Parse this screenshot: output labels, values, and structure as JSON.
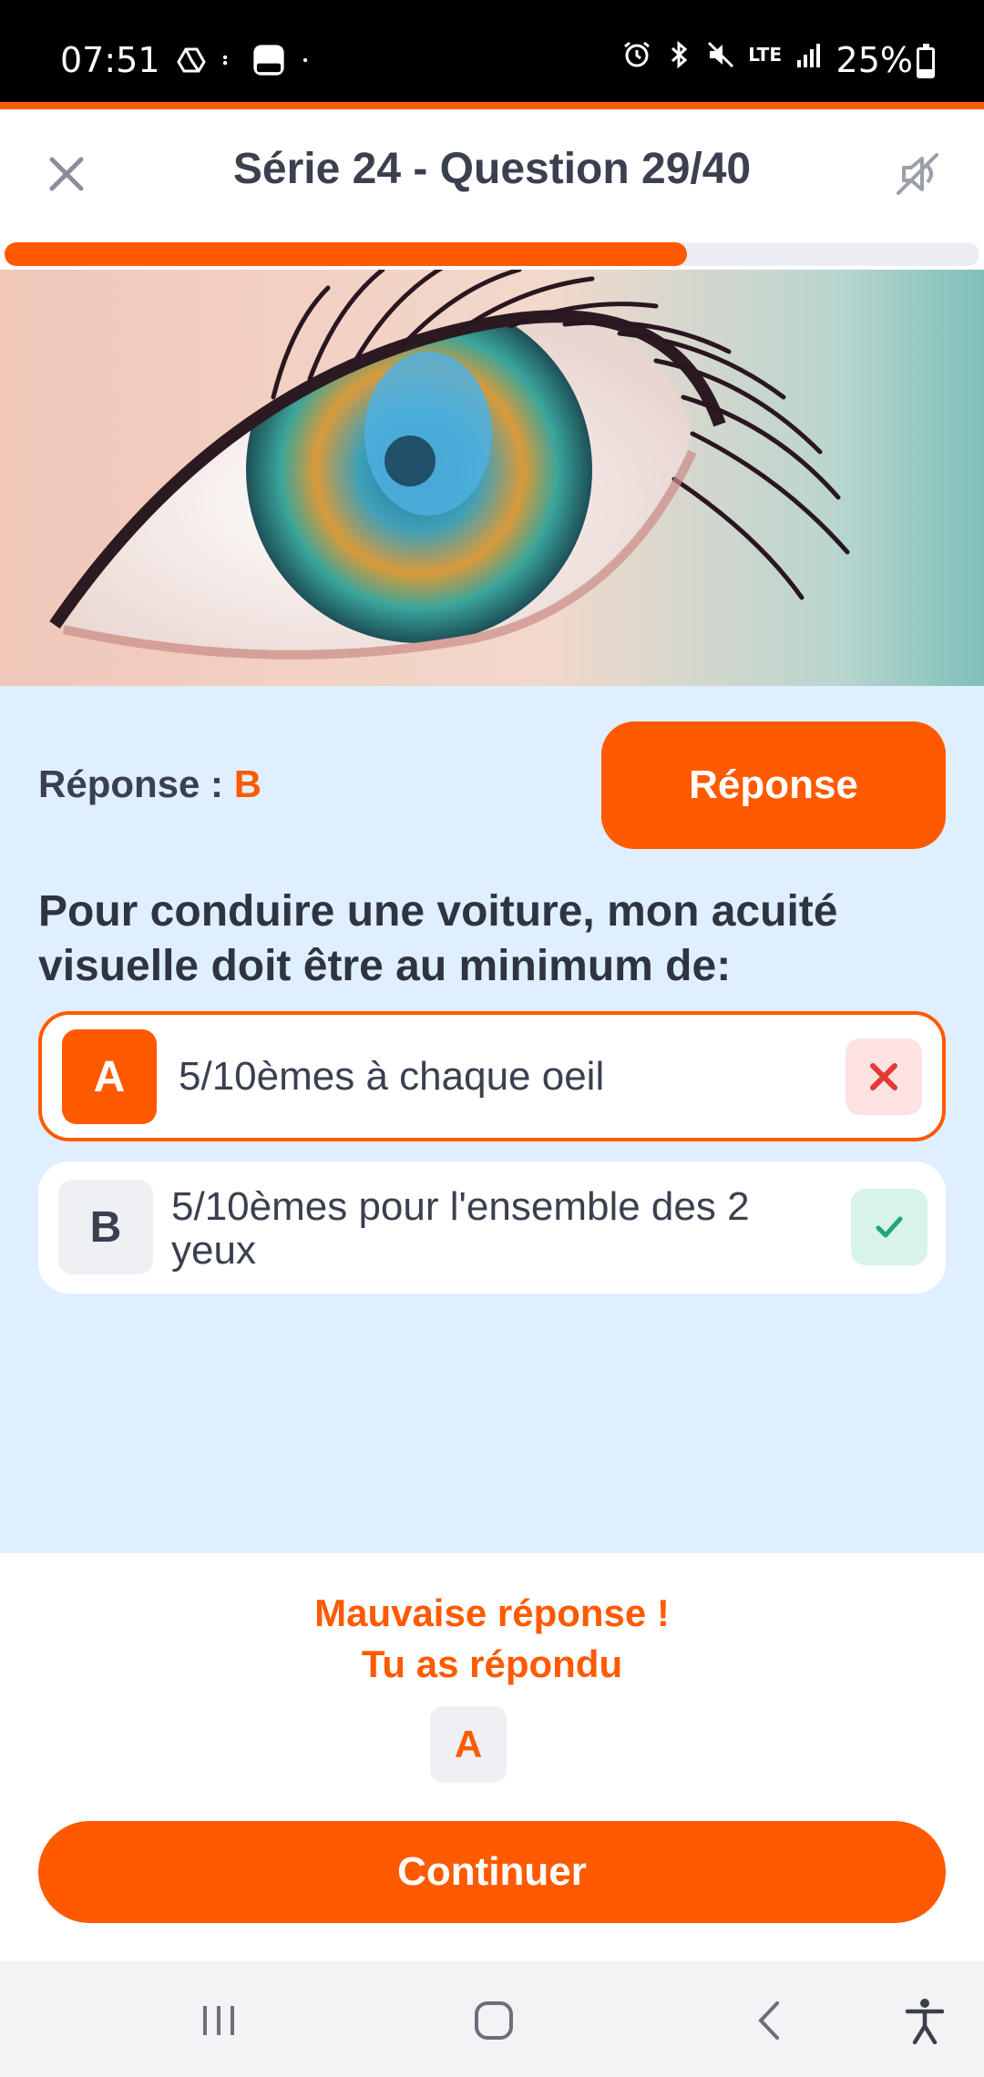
{
  "status_bar": {
    "time": "07:51",
    "battery": "25%",
    "battery_level": 0.25,
    "network": "LTE",
    "icons": [
      "drive-icon",
      "dots-icon",
      "app-icon",
      "dot-icon",
      "alarm-icon",
      "bluetooth-icon",
      "mute-icon",
      "lte-icon",
      "signal-icon",
      "battery-icon"
    ]
  },
  "header": {
    "title": "Série 24 - Question 29/40"
  },
  "progress": {
    "current": 29,
    "total": 40,
    "fraction": 0.7
  },
  "image": {
    "subject": "eye-photo"
  },
  "answer": {
    "label": "Réponse :",
    "value": "B",
    "button": "Réponse"
  },
  "question": {
    "text": "Pour conduire une voiture, mon acuité visuelle doit être au minimum de:"
  },
  "options": [
    {
      "letter": "A",
      "text": "5/10èmes à chaque oeil",
      "status": "wrong"
    },
    {
      "letter": "B",
      "text": "5/10èmes pour l'ensemble des 2 yeux",
      "status": "correct"
    }
  ],
  "feedback": {
    "line1": "Mauvaise réponse !",
    "line2": "Tu as répondu",
    "given": "A",
    "continue": "Continuer"
  },
  "colors": {
    "accent": "#ff5a00",
    "panel": "#e0efff",
    "wrong_bg": "#fde2e2",
    "correct_bg": "#d8f3ea",
    "correct": "#1fa67a",
    "wrong": "#e53935"
  }
}
